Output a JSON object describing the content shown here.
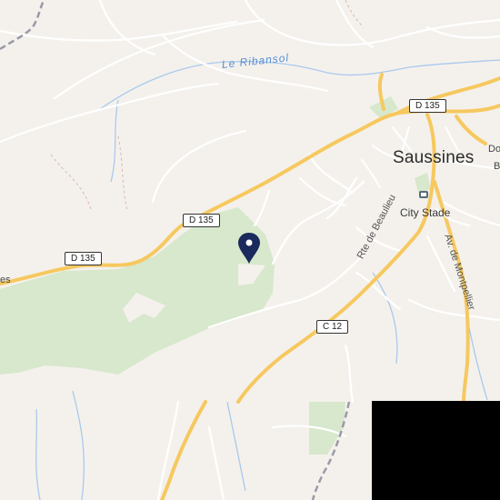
{
  "map": {
    "place_labels": {
      "town": "Saussines",
      "poi": "City Stade",
      "river": "Le Ribansol"
    },
    "road_labels": {
      "rte_beaulieu": "Rte de Beaulieu",
      "av_montpellier": "Av. de Montpellier"
    },
    "shields": {
      "d135_top": "D 135",
      "d135_mid": "D 135",
      "d135_left": "D 135",
      "c12": "C 12"
    },
    "edge_labels": {
      "left": "es",
      "right_top": "Do",
      "right_bottom": "B"
    },
    "icons": {
      "marker": "map-pin-icon",
      "poi": "stadium-icon"
    },
    "colors": {
      "background": "#f4f1ec",
      "park": "#d7e8cc",
      "major_road": "#f6c85f",
      "minor_road": "#ffffff",
      "water": "#a9c9ee",
      "boundary": "#9a9aa8",
      "marker": "#1a2a5c"
    }
  }
}
